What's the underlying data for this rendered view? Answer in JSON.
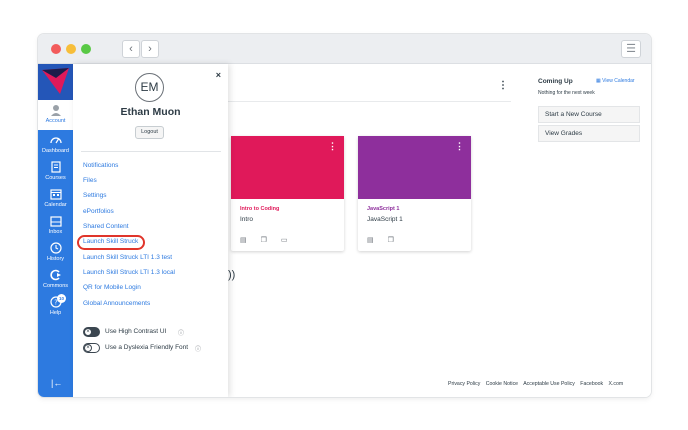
{
  "window": {
    "back": "‹",
    "forward": "›",
    "menu": "☰"
  },
  "nav": {
    "account": "Account",
    "items": [
      {
        "label": "Dashboard",
        "icon": "dashboard-icon"
      },
      {
        "label": "Courses",
        "icon": "courses-icon"
      },
      {
        "label": "Calendar",
        "icon": "calendar-icon"
      },
      {
        "label": "Inbox",
        "icon": "inbox-icon"
      },
      {
        "label": "History",
        "icon": "history-icon"
      },
      {
        "label": "Commons",
        "icon": "commons-icon"
      },
      {
        "label": "Help",
        "icon": "help-icon"
      }
    ],
    "help_badge": "10",
    "collapse": "|←"
  },
  "tray": {
    "close": "×",
    "initials": "EM",
    "name": "Ethan Muon",
    "logout": "Logout",
    "links": [
      "Notifications",
      "Files",
      "Settings",
      "ePortfolios",
      "Shared Content",
      "Launch Skill Struck",
      "Launch Skill Struck LTI 1.3 test",
      "Launch Skill Struck LTI 1.3 local",
      "QR for Mobile Login",
      "Global Announcements"
    ],
    "toggles": [
      {
        "label": "Use High Contrast UI",
        "on": true
      },
      {
        "label": "Use a Dyslexia Friendly Font",
        "on": false
      }
    ]
  },
  "cards": [
    {
      "title": "Intro to Coding",
      "subtitle": "Intro",
      "color": "#e0195a",
      "title_color": "#e0195a"
    },
    {
      "title": "JavaScript 1",
      "subtitle": "JavaScript 1",
      "color": "#8e2f9c",
      "title_color": "#8e2f9c"
    }
  ],
  "main": {
    "paren_text": "))"
  },
  "sidebar": {
    "coming_up": "Coming Up",
    "view_calendar": "View Calendar",
    "nothing": "Nothing for the next week",
    "start_course": "Start a New Course",
    "view_grades": "View Grades"
  },
  "footer": [
    "Privacy Policy",
    "Cookie Notice",
    "Acceptable Use Policy",
    "Facebook",
    "X.com"
  ],
  "colors": {
    "nav_blue": "#2d7ae0",
    "link_blue": "#2d7ae0",
    "highlight": "#e0352b"
  }
}
